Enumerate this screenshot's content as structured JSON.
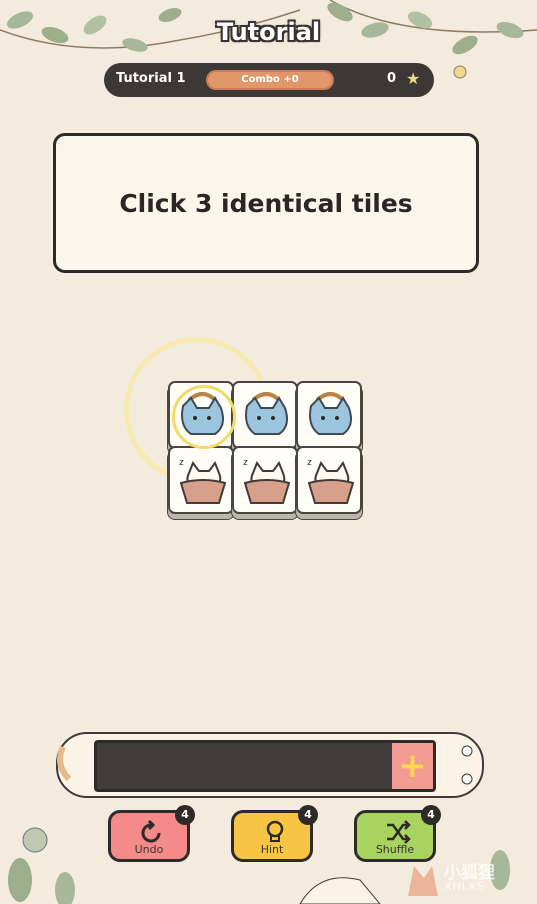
{
  "header": {
    "title": "Tutorial",
    "level_name": "Tutorial 1",
    "combo_label": "Combo +0",
    "score": "0",
    "score_icon": "star-icon"
  },
  "instruction": {
    "text": "Click 3 identical tiles"
  },
  "board": {
    "tiles": [
      {
        "kind": "blue-cat-with-hat",
        "row": 0,
        "col": 0,
        "highlighted": true
      },
      {
        "kind": "blue-cat-with-hat",
        "row": 0,
        "col": 1,
        "highlighted": false
      },
      {
        "kind": "blue-cat-with-hat",
        "row": 0,
        "col": 2,
        "highlighted": false
      },
      {
        "kind": "sleeping-cat-in-basket",
        "row": 1,
        "col": 0,
        "highlighted": false
      },
      {
        "kind": "sleeping-cat-in-basket",
        "row": 1,
        "col": 1,
        "highlighted": false
      },
      {
        "kind": "sleeping-cat-in-basket",
        "row": 1,
        "col": 2,
        "highlighted": false
      }
    ]
  },
  "slot_tray": {
    "add_icon": "plus-icon"
  },
  "tools": [
    {
      "label": "Undo",
      "count": "4",
      "icon": "undo-icon",
      "color": "#f48a8a"
    },
    {
      "label": "Hint",
      "count": "4",
      "icon": "lightbulb-icon",
      "color": "#f7c543"
    },
    {
      "label": "Shuffle",
      "count": "4",
      "icon": "shuffle-icon",
      "color": "#a8d35f"
    }
  ],
  "watermark": {
    "text": "小狐狸",
    "sub": "XHLKS"
  },
  "colors": {
    "background": "#f3ebdd",
    "highlight": "#f0dc66",
    "dark": "#2e2a28"
  }
}
